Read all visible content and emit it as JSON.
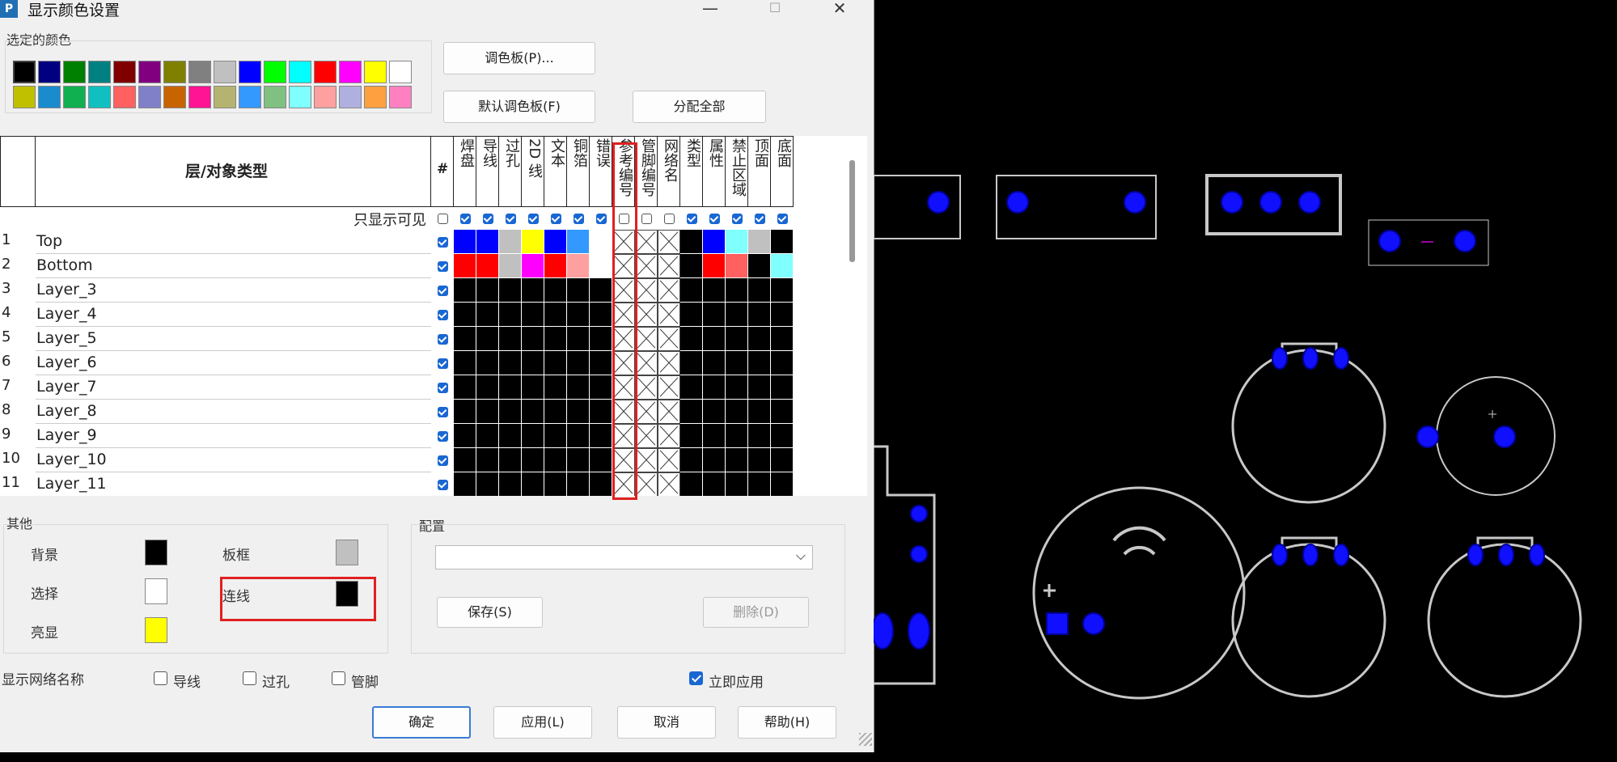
{
  "window": {
    "title": "显示颜色设置",
    "minimize": "—",
    "maximize": "☐",
    "close": "✕"
  },
  "palette": {
    "label": "选定的颜色",
    "row1": [
      "#000000",
      "#000080",
      "#008000",
      "#008080",
      "#800000",
      "#800080",
      "#808000",
      "#808080",
      "#c0c0c0",
      "#0000ff",
      "#00ff00",
      "#00ffff",
      "#ff0000",
      "#ff00ff",
      "#ffff00",
      "#ffffff"
    ],
    "row2": [
      "#c0c000",
      "#1a8cce",
      "#10b050",
      "#10c0c0",
      "#ff6060",
      "#8080c8",
      "#c86400",
      "#ff1493",
      "#b4b470",
      "#3399ff",
      "#80c080",
      "#80ffff",
      "#ffa0a0",
      "#b0b0e0",
      "#ffa040",
      "#ff80c0"
    ]
  },
  "buttons": {
    "palette": "调色板(P)...",
    "default_palette": "默认调色板(F)",
    "assign_all": "分配全部",
    "save": "保存(S)",
    "delete": "删除(D)",
    "ok": "确定",
    "apply": "应用(L)",
    "cancel": "取消",
    "help": "帮助(H)"
  },
  "grid": {
    "header_title": "层/对象类型",
    "hash": "#",
    "visible_only": "只显示可见",
    "columns": [
      "焊盘",
      "导线",
      "过孔",
      "2D 线",
      "文本",
      "铜箔",
      "错误",
      "参考编号",
      "管脚编号",
      "网络名",
      "类型",
      "属性",
      "禁止区域",
      "顶面",
      "底面"
    ],
    "visible_checks": [
      true,
      true,
      true,
      true,
      true,
      true,
      true,
      false,
      false,
      false,
      true,
      true,
      true,
      true,
      true
    ],
    "layers": [
      {
        "num": "1",
        "name": "Top",
        "colors": [
          "#0000ff",
          "#0000ff",
          "#c0c0c0",
          "#ffff00",
          "#0000ff",
          "#3399ff",
          "#ffffff",
          "x",
          "x",
          "x",
          "#000000",
          "#0000ff",
          "#80ffff",
          "#c0c0c0",
          "#000000"
        ]
      },
      {
        "num": "2",
        "name": "Bottom",
        "colors": [
          "#ff0000",
          "#ff0000",
          "#c0c0c0",
          "#ff00ff",
          "#ff0000",
          "#ffa0a0",
          "#ffffff",
          "x",
          "x",
          "x",
          "#000000",
          "#ff0000",
          "#ff6060",
          "#000000",
          "#80ffff"
        ]
      },
      {
        "num": "3",
        "name": "Layer_3"
      },
      {
        "num": "4",
        "name": "Layer_4"
      },
      {
        "num": "5",
        "name": "Layer_5"
      },
      {
        "num": "6",
        "name": "Layer_6"
      },
      {
        "num": "7",
        "name": "Layer_7"
      },
      {
        "num": "8",
        "name": "Layer_8"
      },
      {
        "num": "9",
        "name": "Layer_9"
      },
      {
        "num": "10",
        "name": "Layer_10"
      },
      {
        "num": "11",
        "name": "Layer_11"
      }
    ]
  },
  "other": {
    "label": "其他",
    "background": {
      "label": "背景",
      "color": "#000000"
    },
    "selection": {
      "label": "选择",
      "color": "#ffffff"
    },
    "highlight": {
      "label": "亮显",
      "color": "#ffff00"
    },
    "board_frame": {
      "label": "板框",
      "color": "#c0c0c0"
    },
    "connection": {
      "label": "连线",
      "color": "#000000"
    }
  },
  "config": {
    "label": "配置",
    "value": ""
  },
  "net_names": {
    "label": "显示网络名称",
    "trace": "导线",
    "via": "过孔",
    "pin": "管脚",
    "apply_now": "立即应用"
  }
}
